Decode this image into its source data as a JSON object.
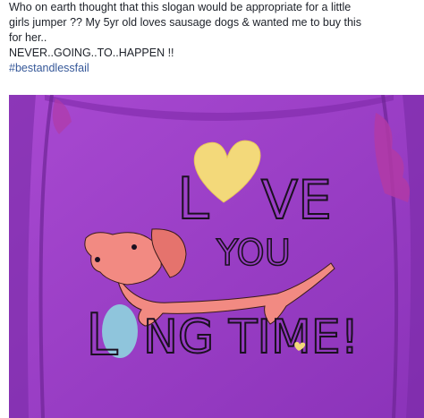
{
  "post": {
    "lines": [
      "Who on earth thought that this slogan would be appropriate for a little",
      "girls jumper ?? My 5yr old loves sausage dogs & wanted me to buy this",
      "for her..",
      "NEVER..GOING..TO..HAPPEN !!"
    ],
    "hashtag": "#bestandlessfail"
  },
  "photo": {
    "slogan": {
      "line1_left": "L",
      "line1_right": "VE",
      "line2": "YOU",
      "line3_left": "L",
      "line3_right": "NG TIME!"
    },
    "colors": {
      "jumper": "#9a3fc7",
      "jumper_dark": "#6e2596",
      "heart": "#f3d97a",
      "dog": "#f28a82",
      "oval": "#8fc5dc",
      "ruffle": "#b13aa6"
    }
  }
}
